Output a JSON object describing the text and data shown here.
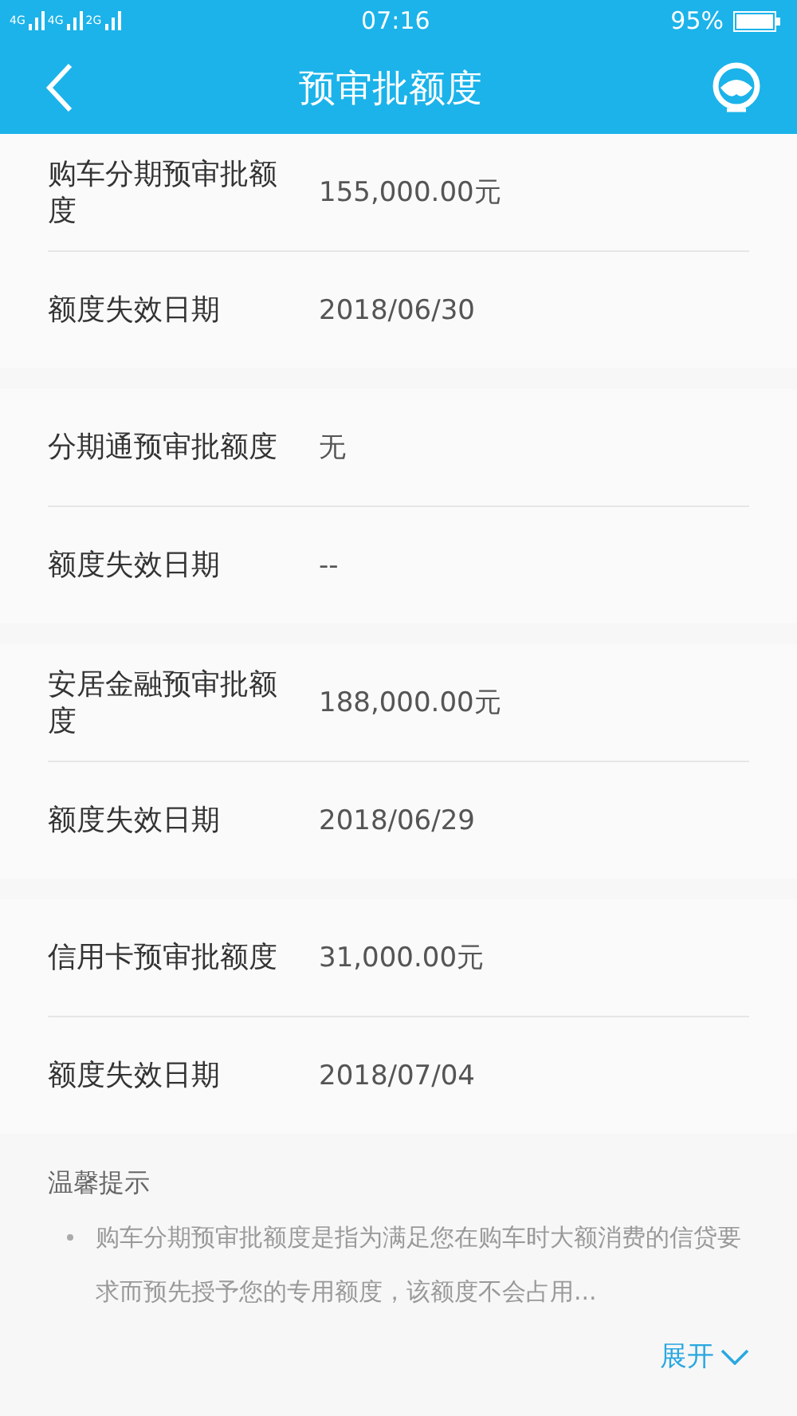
{
  "status_bar": {
    "networks": [
      "4G",
      "4G",
      "2G"
    ],
    "time": "07:16",
    "battery": "95%"
  },
  "header": {
    "title": "预审批额度"
  },
  "sections": [
    {
      "rows": [
        {
          "label": "购车分期预审批额度",
          "value": "155,000.00元"
        },
        {
          "label": "额度失效日期",
          "value": "2018/06/30"
        }
      ]
    },
    {
      "rows": [
        {
          "label": "分期通预审批额度",
          "value": "无"
        },
        {
          "label": "额度失效日期",
          "value": "--"
        }
      ]
    },
    {
      "rows": [
        {
          "label": "安居金融预审批额度",
          "value": "188,000.00元"
        },
        {
          "label": "额度失效日期",
          "value": "2018/06/29"
        }
      ]
    },
    {
      "rows": [
        {
          "label": "信用卡预审批额度",
          "value": "31,000.00元"
        },
        {
          "label": "额度失效日期",
          "value": "2018/07/04"
        }
      ]
    }
  ],
  "tips": {
    "title": "温馨提示",
    "items": [
      "购车分期预审批额度是指为满足您在购车时大额消费的信贷要求而预先授予您的专用额度，该额度不会占用..."
    ],
    "expand": "展开"
  }
}
